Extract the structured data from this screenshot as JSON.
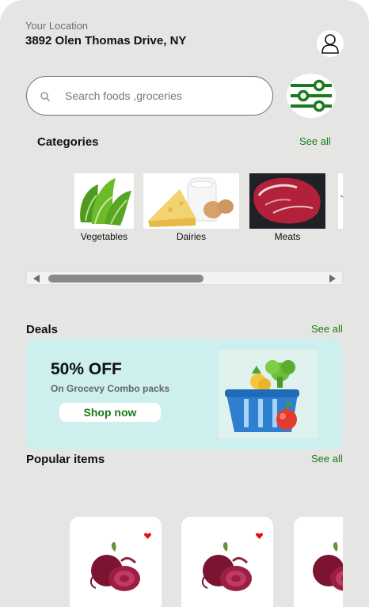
{
  "location": {
    "label": "Your Location",
    "address": "3892 Olen Thomas Drive, NY"
  },
  "icons": {
    "profile": "user-icon",
    "search": "search-icon",
    "filter": "sliders-icon",
    "favorite": "heart-icon"
  },
  "search": {
    "placeholder": "Search foods ,groceries",
    "value": ""
  },
  "categories": {
    "title": "Categories",
    "see_all": "See all",
    "items": [
      {
        "label": "Vegetables"
      },
      {
        "label": "Dairies"
      },
      {
        "label": "Meats"
      }
    ]
  },
  "deals": {
    "title": "Deals",
    "see_all": "See all",
    "banner": {
      "headline": "50% OFF",
      "subtitle": "On Grocevy Combo packs",
      "button": "Shop now"
    }
  },
  "popular": {
    "title": "Popular items",
    "see_all": "See all"
  },
  "colors": {
    "accent": "#1a7a1a",
    "background": "#e5e6e4",
    "deal_background": "#cdefee",
    "heart": "#e01010"
  }
}
